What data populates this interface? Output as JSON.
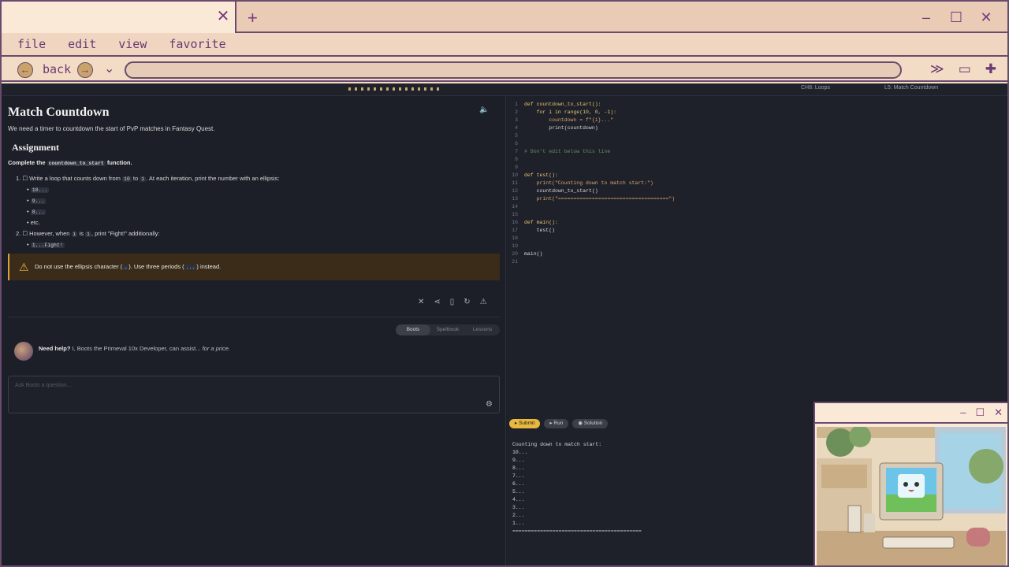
{
  "window": {
    "tab_close": "✕",
    "new_tab": "+",
    "minimize": "–",
    "maximize": "☐",
    "close": "✕"
  },
  "menu": [
    "file",
    "edit",
    "view",
    "favorite"
  ],
  "nav": {
    "back_label": "back",
    "url": ""
  },
  "course": {
    "chapter_select": "CH8: Loops",
    "lesson_select": "L5: Match Countdown"
  },
  "lesson": {
    "title": "Match Countdown",
    "subtitle": "We need a timer to countdown the start of PvP matches in Fantasy Quest.",
    "assignment_heading": "Assignment",
    "complete_prefix": "Complete the",
    "complete_code": "countdown_to_start",
    "complete_suffix": "function.",
    "step1_prefix": "1. ☐ Write a loop that counts down from",
    "step1_from": "10",
    "step1_mid": "to",
    "step1_to": "1",
    "step1_suffix": ". At each iteration, print the number with an ellipsis:",
    "step1_examples": [
      "10...",
      "9...",
      "8..."
    ],
    "step1_etc": "etc.",
    "step2_prefix": "2. ☐ However, when",
    "step2_var": "i",
    "step2_mid": "is",
    "step2_val": "1",
    "step2_suffix": ", print \"Fight!\" additionally:",
    "step2_example": "1...Fight!",
    "warning_prefix": "Do not use the ellipsis character (",
    "warning_char": "…",
    "warning_mid": "). Use three periods (",
    "warning_periods": "...",
    "warning_suffix": ") instead."
  },
  "help_tabs": [
    "Boots",
    "Spellbook",
    "Lessons"
  ],
  "help": {
    "bold": "Need help?",
    "text": " I, Boots the Primeval 10x Developer, can assist...",
    "em": " for a price."
  },
  "ask": {
    "placeholder": "Ask Boots a question..."
  },
  "code_lines": [
    {
      "n": "1",
      "text": "def countdown_to_start():"
    },
    {
      "n": "2",
      "text": "    for i in range(10, 0, -1):"
    },
    {
      "n": "3",
      "text": "        countdown = f\"{i}...\""
    },
    {
      "n": "4",
      "text": "        print(countdown)"
    },
    {
      "n": "5",
      "text": ""
    },
    {
      "n": "6",
      "text": ""
    },
    {
      "n": "7",
      "text": "# Don't edit below this line"
    },
    {
      "n": "8",
      "text": ""
    },
    {
      "n": "9",
      "text": ""
    },
    {
      "n": "10",
      "text": "def test():"
    },
    {
      "n": "11",
      "text": "    print(\"Counting down to match start:\")"
    },
    {
      "n": "12",
      "text": "    countdown_to_start()"
    },
    {
      "n": "13",
      "text": "    print(\"====================================\")"
    },
    {
      "n": "14",
      "text": ""
    },
    {
      "n": "15",
      "text": ""
    },
    {
      "n": "16",
      "text": "def main():"
    },
    {
      "n": "17",
      "text": "    test()"
    },
    {
      "n": "18",
      "text": ""
    },
    {
      "n": "19",
      "text": ""
    },
    {
      "n": "20",
      "text": "main()"
    },
    {
      "n": "21",
      "text": ""
    }
  ],
  "buttons": {
    "submit": "Submit",
    "run": "Run",
    "solution": "Solution"
  },
  "output": [
    "Counting down to match start:",
    "10...",
    "9...",
    "8...",
    "7...",
    "6...",
    "5...",
    "4...",
    "3...",
    "2...",
    "1...",
    "=========================================="
  ],
  "colors": {
    "accent": "#e8b93e",
    "frame": "#6a4a6e",
    "page_bg": "#1c1f28",
    "warning_bg": "#3a2c18"
  },
  "icons": [
    "back-arrow-icon",
    "forward-arrow-icon",
    "chevron-down-icon",
    "double-chevron-icon",
    "folder-icon",
    "puzzle-icon",
    "speaker-icon",
    "share-icon",
    "bookmark-icon",
    "refresh-icon",
    "warning-icon",
    "gear-icon"
  ]
}
